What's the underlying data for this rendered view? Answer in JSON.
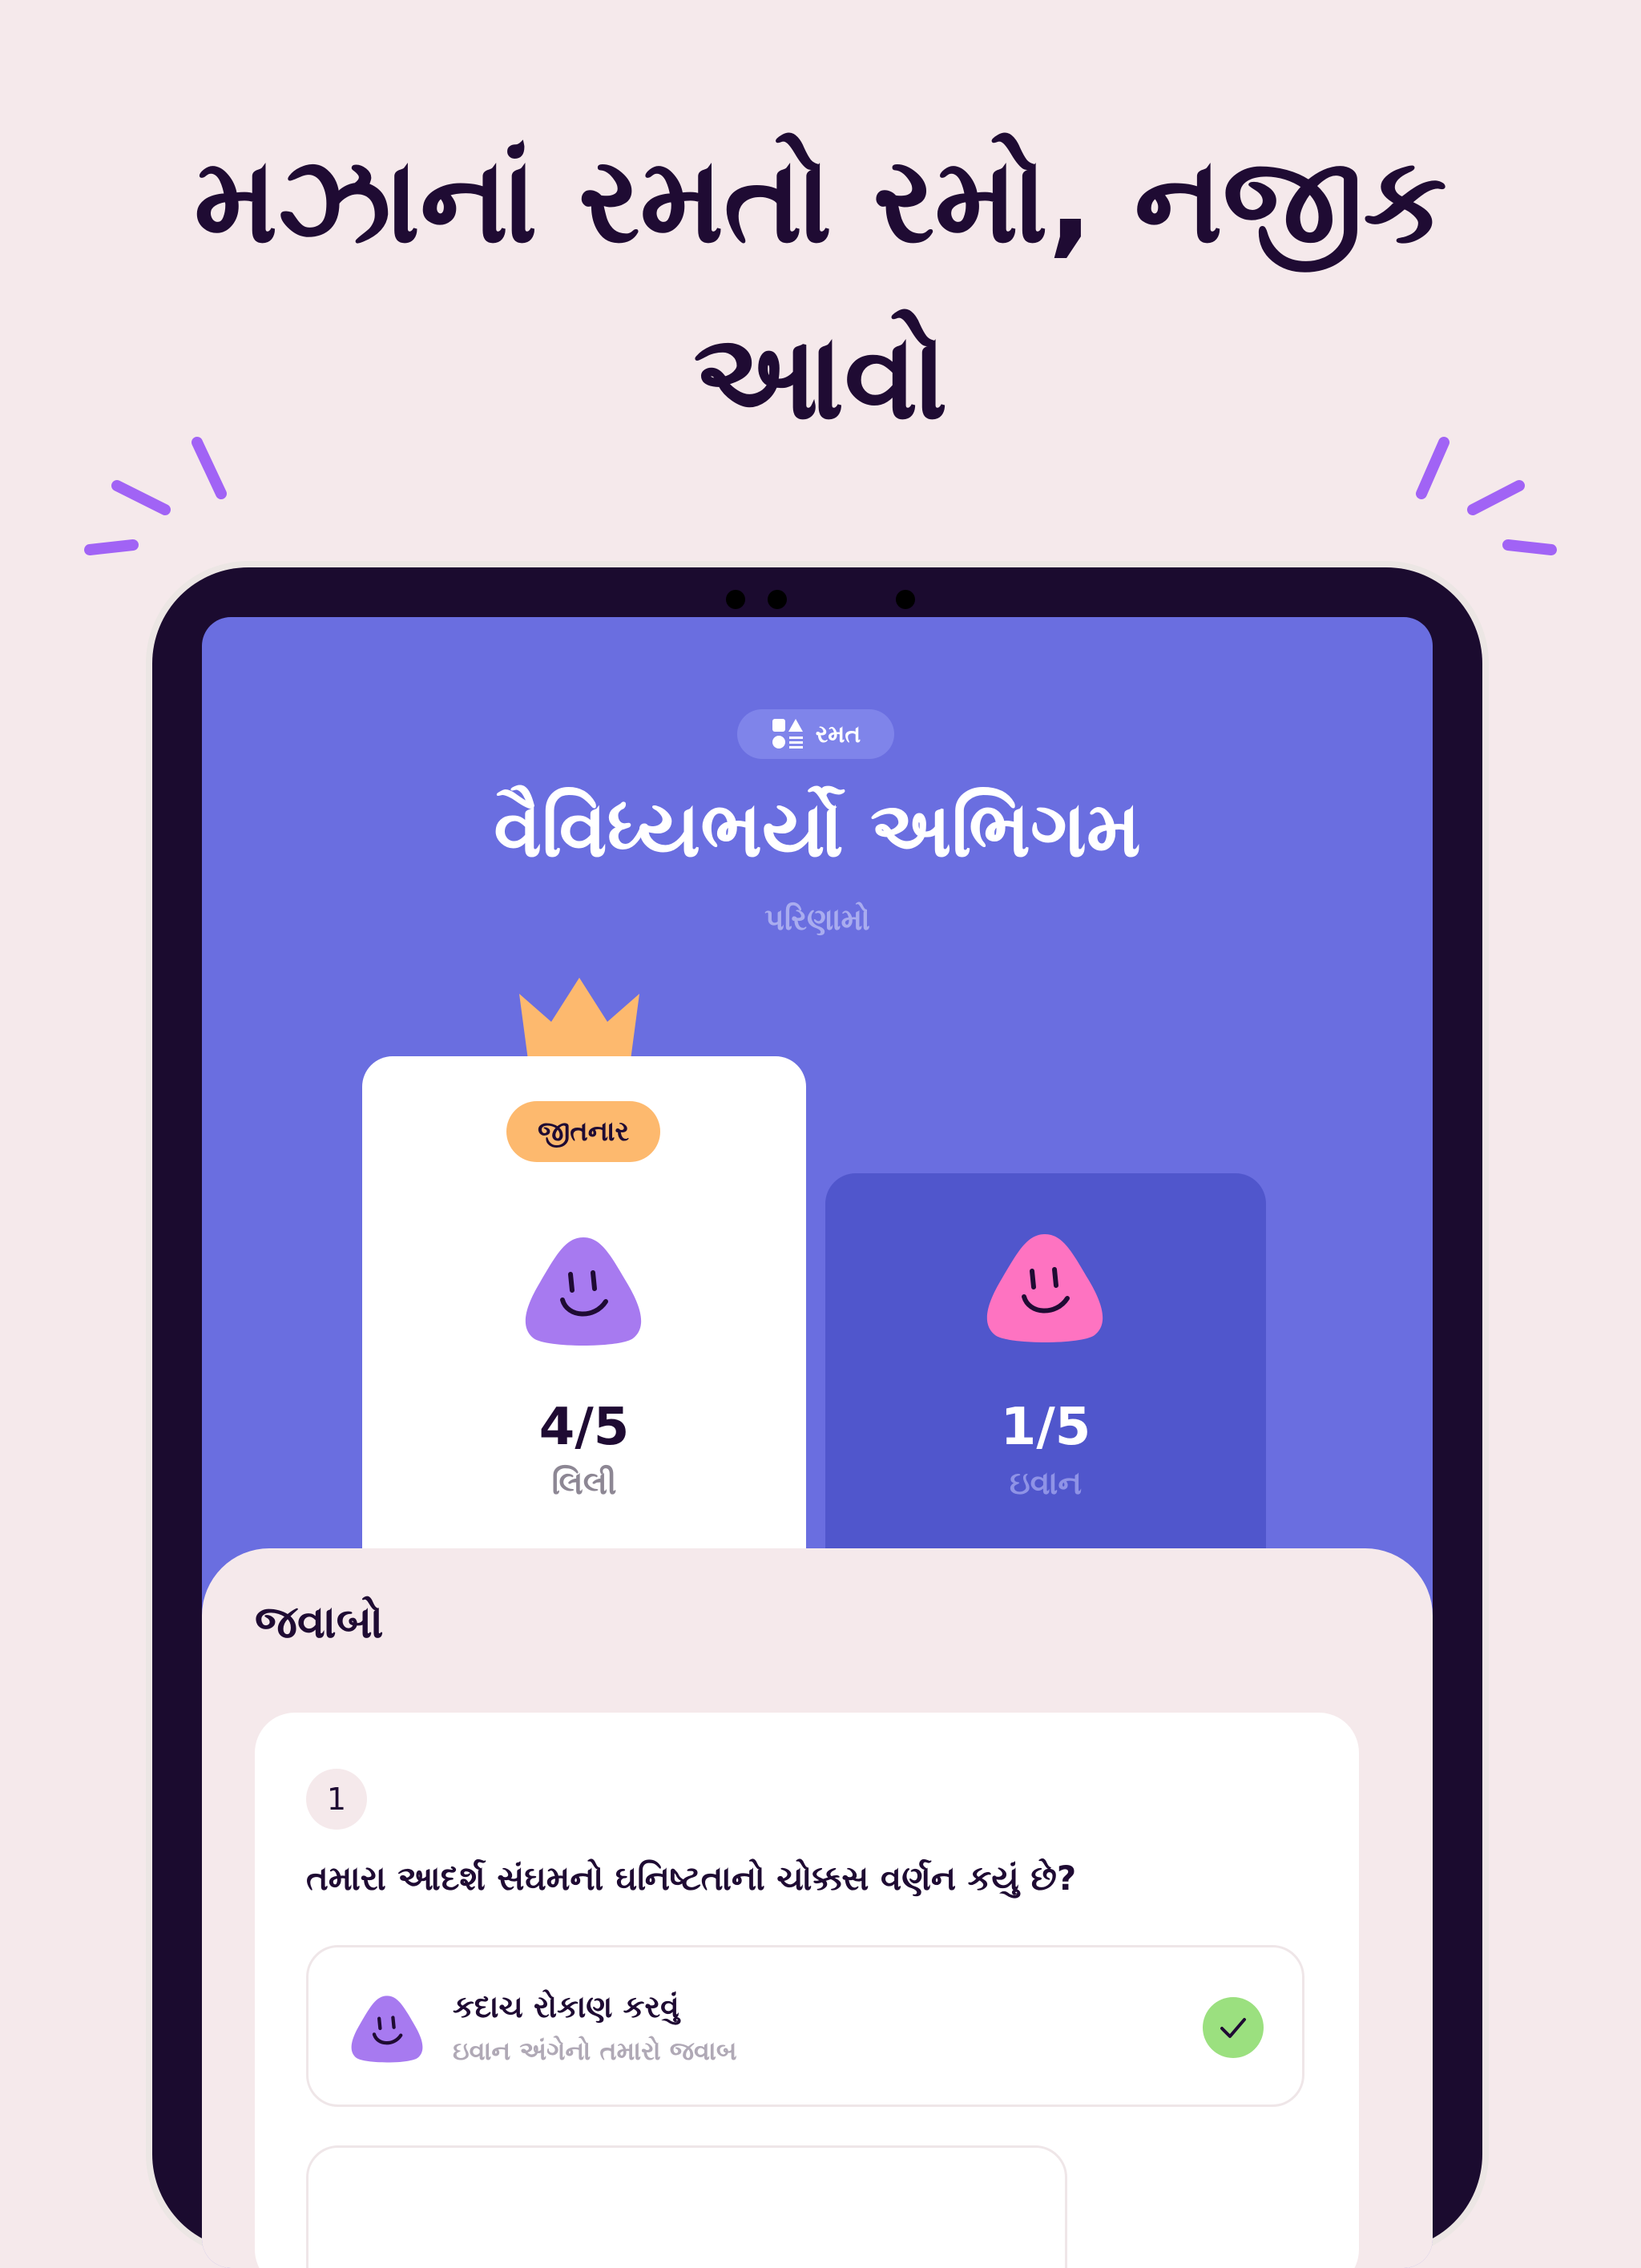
{
  "headline": {
    "line1": "મઝાનાં રમતો રમો, નજીક",
    "line2": "આવો"
  },
  "colors": {
    "background": "#f5e9eb",
    "screen": "#6a6ee0",
    "accent_spark": "#a163f5",
    "winner_badge": "#fdb96e",
    "player1": "#a77af0",
    "player2": "#fe73c1",
    "check": "#9be07f"
  },
  "app": {
    "category_chip": {
      "icon": "shapes-icon",
      "label": "રમત"
    },
    "title": "વૈવિધ્યભર્યો અભિગમ",
    "subtitle": "પરિણામો",
    "players": [
      {
        "badge": "જીતનાર",
        "score": "4/5",
        "name": "લિલી",
        "avatar_icon": "smiley-blob-purple-icon",
        "winner": true
      },
      {
        "score": "1/5",
        "name": "ઇવાન",
        "avatar_icon": "smiley-blob-pink-icon",
        "winner": false
      }
    ],
    "answers_section": {
      "title": "જવાબો",
      "questions": [
        {
          "number": "1",
          "text": "તમારા આદર્શ સંઘમનો ઘનિષ્ટતાનો ચોક્કસ વર્ણન કયું છે?",
          "answers": [
            {
              "label": "કદાચ રોકાણ કરવું",
              "sub": "ઇવાન અંગેનો તમારો જવાબ",
              "correct": true
            }
          ]
        }
      ]
    }
  }
}
